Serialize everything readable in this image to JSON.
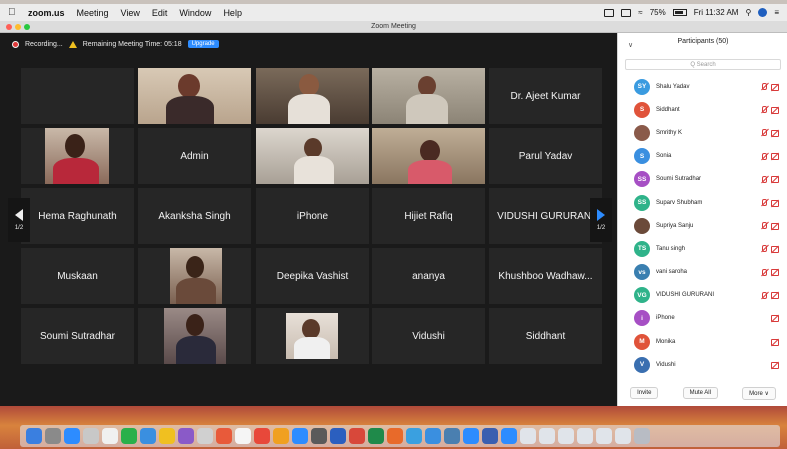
{
  "menubar": {
    "app": "zoom.us",
    "items": [
      "Meeting",
      "View",
      "Edit",
      "Window",
      "Help"
    ],
    "battery": "75%",
    "clock": "Fri 11:32 AM"
  },
  "window": {
    "title": "Zoom Meeting"
  },
  "recording": {
    "label": "Recording...",
    "remaining": "Remaining Meeting Time: 05:18",
    "upgrade": "Upgrade"
  },
  "pager": {
    "left": "1/2",
    "right": "1/2"
  },
  "tiles": [
    {
      "name": "",
      "photo": false
    },
    {
      "name": "",
      "photo": true
    },
    {
      "name": "",
      "photo": true
    },
    {
      "name": "",
      "photo": true
    },
    {
      "name": "Dr. Ajeet Kumar",
      "photo": false
    },
    {
      "name": "",
      "photo": true
    },
    {
      "name": "Admin",
      "photo": false
    },
    {
      "name": "",
      "photo": true
    },
    {
      "name": "",
      "photo": true
    },
    {
      "name": "Parul Yadav",
      "photo": false
    },
    {
      "name": "Hema Raghunath",
      "photo": false
    },
    {
      "name": "Akanksha Singh",
      "photo": false
    },
    {
      "name": "iPhone",
      "photo": false
    },
    {
      "name": "Hijiet Rafiq",
      "photo": false
    },
    {
      "name": "VIDUSHI GURURANI",
      "photo": false
    },
    {
      "name": "Muskaan",
      "photo": false
    },
    {
      "name": "",
      "photo": true
    },
    {
      "name": "Deepika Vashist",
      "photo": false
    },
    {
      "name": "ananya",
      "photo": false
    },
    {
      "name": "Khushboo Wadhaw...",
      "photo": false
    },
    {
      "name": "Soumi Sutradhar",
      "photo": false
    },
    {
      "name": "",
      "photo": true
    },
    {
      "name": "",
      "photo": true
    },
    {
      "name": "Vidushi",
      "photo": false
    },
    {
      "name": "Siddhant",
      "photo": false
    }
  ],
  "participants": {
    "title": "Participants (50)",
    "search_placeholder": "Q Search",
    "list": [
      {
        "initials": "SY",
        "name": "Shalu Yadav",
        "color": "#3a9be0",
        "video": false
      },
      {
        "initials": "S",
        "name": "Siddhant",
        "color": "#e0533a",
        "video": false
      },
      {
        "initials": "",
        "name": "Smrithy K",
        "color": "#8a5a4a",
        "video": false
      },
      {
        "initials": "S",
        "name": "Sonia",
        "color": "#3a8fe0",
        "video": false
      },
      {
        "initials": "SS",
        "name": "Soumi Sutradhar",
        "color": "#a64fc4",
        "video": false
      },
      {
        "initials": "SS",
        "name": "Suparv Shubham",
        "color": "#2fb38a",
        "video": false
      },
      {
        "initials": "",
        "name": "Supriya Sanju",
        "color": "#6b4a3a",
        "video": false
      },
      {
        "initials": "TS",
        "name": "Tanu singh",
        "color": "#2fb38a",
        "video": false
      },
      {
        "initials": "vs",
        "name": "vani saroha",
        "color": "#3a7fb0",
        "video": false
      },
      {
        "initials": "VG",
        "name": "VIDUSHI GURURANI",
        "color": "#2fb38a",
        "video": false
      },
      {
        "initials": "i",
        "name": "iPhone",
        "color": "#a64fc4",
        "video": false
      },
      {
        "initials": "M",
        "name": "Monika",
        "color": "#e0533a",
        "video": false
      },
      {
        "initials": "V",
        "name": "Vidushi",
        "color": "#3a6fb0",
        "video": false
      }
    ],
    "buttons": {
      "invite": "Invite",
      "mute_all": "Mute All",
      "more": "More ∨"
    }
  }
}
